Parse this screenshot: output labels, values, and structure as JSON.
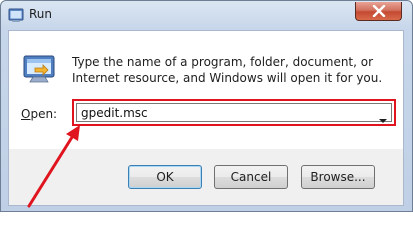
{
  "window": {
    "title": "Run",
    "close_icon": "close-icon",
    "app_icon": "run-app-icon"
  },
  "dialog": {
    "description": "Type the name of a program, folder, document, or Internet resource, and Windows will open it for you.",
    "open_label_prefix": "O",
    "open_label_rest": "pen:",
    "open_value": "gpedit.msc",
    "dropdown_icon": "chevron-down-icon"
  },
  "buttons": {
    "ok": "OK",
    "cancel": "Cancel",
    "browse": "Browse..."
  },
  "annotation": {
    "highlight_color": "#e0141e",
    "arrow_icon": "red-arrow-icon"
  }
}
